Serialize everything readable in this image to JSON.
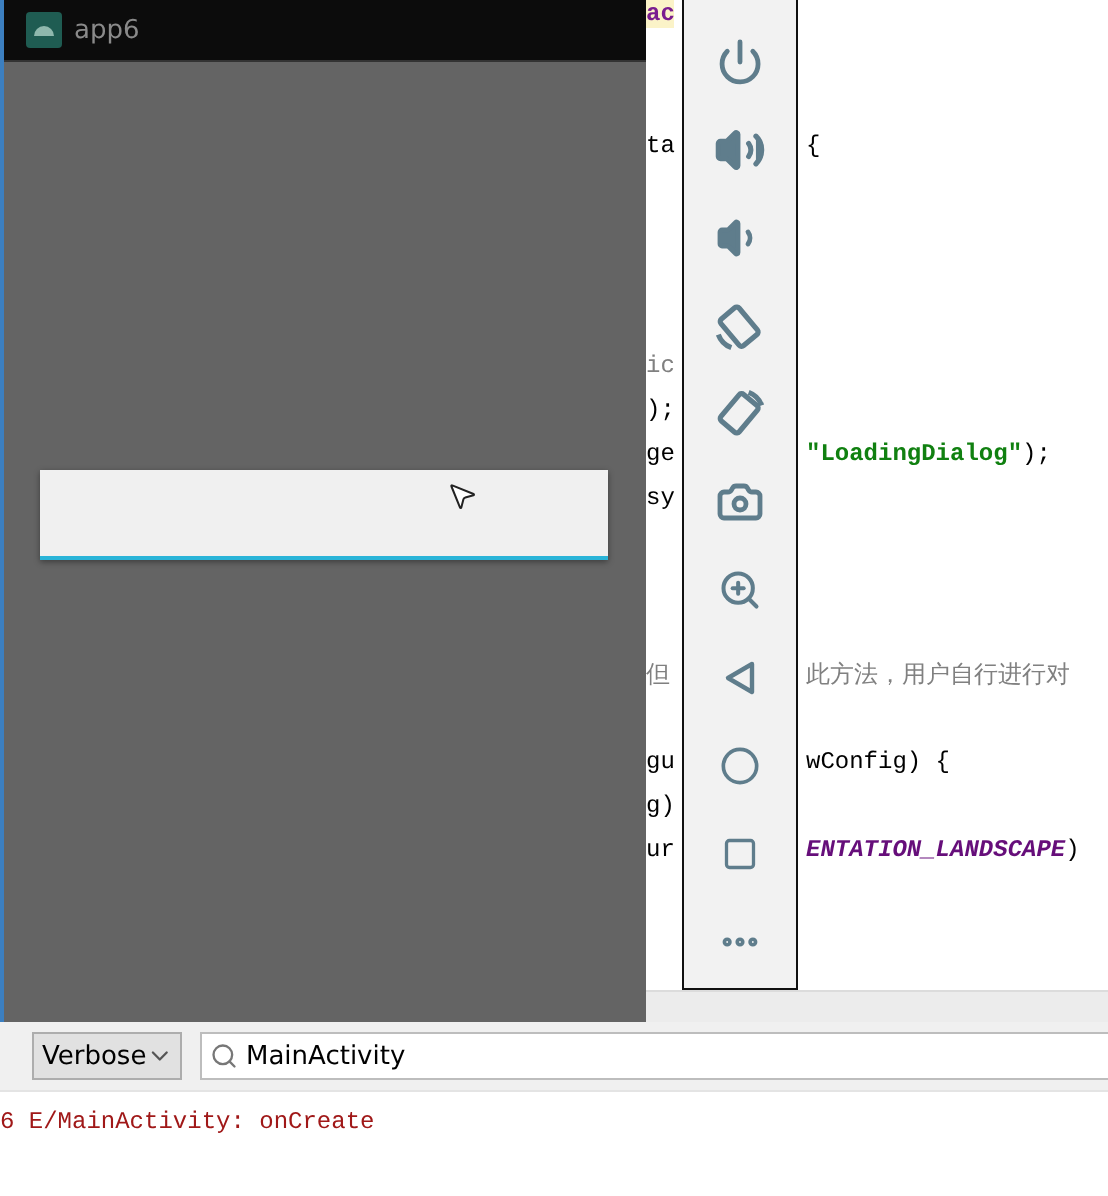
{
  "editor": {
    "lines": [
      {
        "kind": "code",
        "left": [
          {
            "text": "ac",
            "kind": "keyword"
          }
        ]
      },
      {
        "kind": "blank"
      },
      {
        "kind": "blank"
      },
      {
        "kind": "code",
        "left": [
          {
            "text": "ta",
            "kind": "plain"
          }
        ],
        "right": [
          {
            "text": "{",
            "kind": "plain"
          }
        ]
      },
      {
        "kind": "blank"
      },
      {
        "kind": "blank"
      },
      {
        "kind": "blank"
      },
      {
        "kind": "blank"
      },
      {
        "kind": "code",
        "left": [
          {
            "text": "ic",
            "kind": "comment"
          }
        ]
      },
      {
        "kind": "code",
        "left": [
          {
            "text": ");",
            "kind": "plain"
          }
        ]
      },
      {
        "kind": "code",
        "left": [
          {
            "text": "ge",
            "kind": "plain"
          }
        ],
        "right": [
          {
            "text": "\"LoadingDialog\"",
            "kind": "string"
          },
          {
            "text": ");",
            "kind": "plain"
          }
        ]
      },
      {
        "kind": "code",
        "left": [
          {
            "text": "sy",
            "kind": "plain"
          }
        ]
      },
      {
        "kind": "blank"
      },
      {
        "kind": "blank"
      },
      {
        "kind": "blank"
      },
      {
        "kind": "code",
        "left": [
          {
            "text": "但",
            "kind": "comment"
          }
        ],
        "right": [
          {
            "text": "此方法，用户自行进行对",
            "kind": "comment"
          }
        ]
      },
      {
        "kind": "blank"
      },
      {
        "kind": "code",
        "left": [
          {
            "text": "gu",
            "kind": "plain"
          }
        ],
        "right": [
          {
            "text": "wConfig) {",
            "kind": "plain"
          }
        ]
      },
      {
        "kind": "code",
        "left": [
          {
            "text": "g)",
            "kind": "plain"
          }
        ]
      },
      {
        "kind": "code",
        "left": [
          {
            "text": "ur",
            "kind": "plain"
          }
        ],
        "right": [
          {
            "text": "ENTATION_LANDSCAPE",
            "kind": "constant"
          },
          {
            "text": ")",
            "kind": "plain"
          }
        ]
      }
    ]
  },
  "emulator": {
    "title": "app6"
  },
  "logcat": {
    "level": "Verbose",
    "search": "MainActivity",
    "lines": [
      {
        "text": "6 E/MainActivity: onCreate",
        "kind": "error"
      }
    ]
  }
}
